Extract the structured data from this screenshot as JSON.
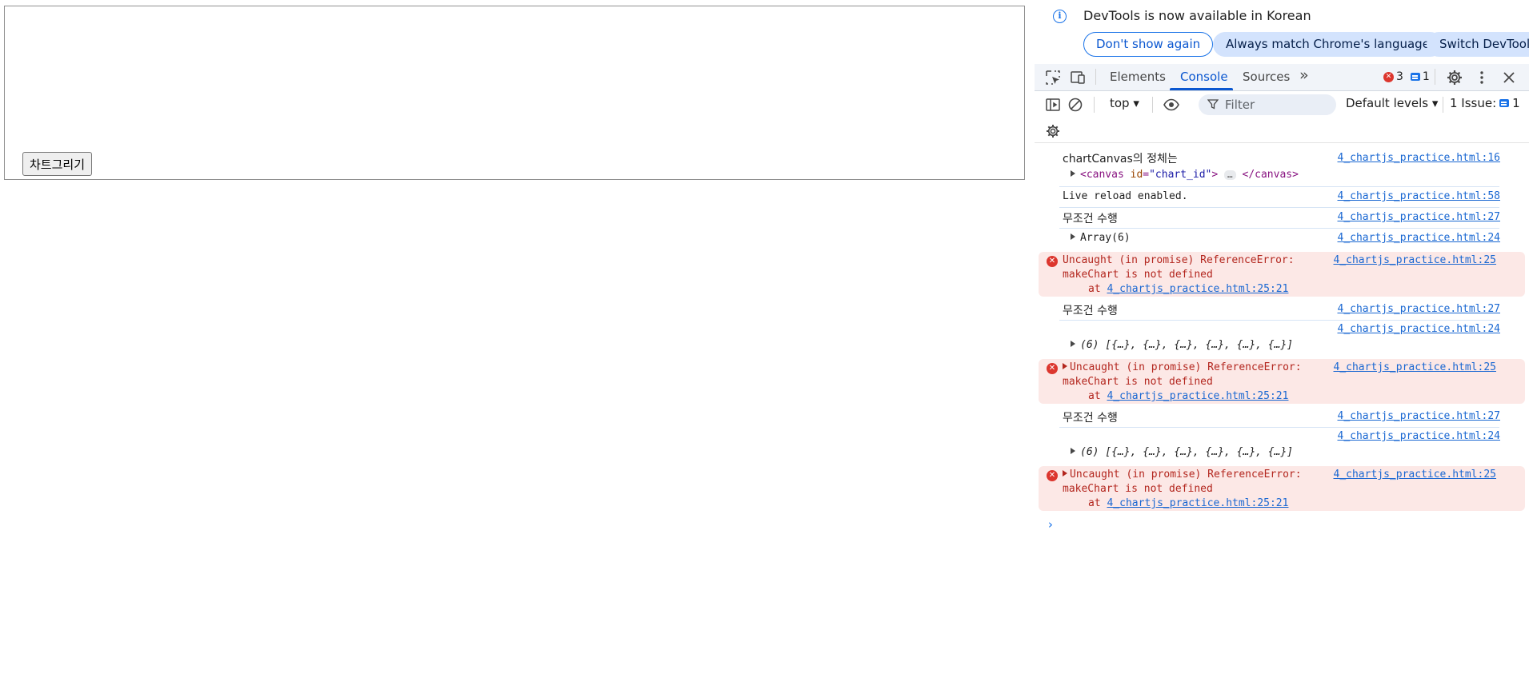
{
  "page": {
    "button_label": "차트그리기"
  },
  "infobar": {
    "icon": "info-icon",
    "message": "DevTools is now available in Korean",
    "buttons": {
      "dont_show": "Don't show again",
      "match_language": "Always match Chrome's language",
      "switch": "Switch DevTools"
    }
  },
  "tabbar": {
    "tabs": [
      {
        "label": "Elements",
        "active": false
      },
      {
        "label": "Console",
        "active": true
      },
      {
        "label": "Sources",
        "active": false
      }
    ],
    "more": "»",
    "error_count": "3",
    "message_count": "1"
  },
  "toolbar": {
    "context": "top",
    "filter_placeholder": "Filter",
    "levels": "Default levels",
    "issues_label": "1 Issue:",
    "issues_count": "1"
  },
  "console": {
    "entries": [
      {
        "text": "chartCanvas의 정체는",
        "source": "4_chartjs_practice.html:16"
      },
      {
        "canvas_tag_open": "<canvas",
        "canvas_attr": "id",
        "canvas_val": "\"chart_id\"",
        "canvas_close": "</canvas>"
      },
      {
        "text": "Live reload enabled.",
        "source": "4_chartjs_practice.html:58"
      },
      {
        "text": "무조건 수행",
        "source": "4_chartjs_practice.html:27"
      },
      {
        "text": "Array(6)",
        "source": "4_chartjs_practice.html:24"
      },
      {
        "line1": "Uncaught (in promise) ReferenceError:",
        "line2": "makeChart is not defined",
        "at": "at",
        "at_link": "4_chartjs_practice.html:25:21",
        "source": "4_chartjs_practice.html:25"
      },
      {
        "text": "무조건 수행",
        "source": "4_chartjs_practice.html:27"
      },
      {
        "text": "(6) [{…}, {…}, {…}, {…}, {…}, {…}]",
        "source": "4_chartjs_practice.html:24"
      },
      {
        "line1": "Uncaught (in promise) ReferenceError:",
        "line2": "makeChart is not defined",
        "at": "at",
        "at_link": "4_chartjs_practice.html:25:21",
        "source": "4_chartjs_practice.html:25"
      },
      {
        "text": "무조건 수행",
        "source": "4_chartjs_practice.html:27"
      },
      {
        "text": "(6) [{…}, {…}, {…}, {…}, {…}, {…}]",
        "source": "4_chartjs_practice.html:24"
      },
      {
        "line1": "Uncaught (in promise) ReferenceError:",
        "line2": "makeChart is not defined",
        "at": "at",
        "at_link": "4_chartjs_practice.html:25:21",
        "source": "4_chartjs_practice.html:25"
      }
    ],
    "prompt": "›"
  },
  "colors": {
    "accent": "#0b57d0",
    "error_bg": "#fce8e6",
    "error_text": "#b3261e",
    "link": "#1967d2"
  }
}
